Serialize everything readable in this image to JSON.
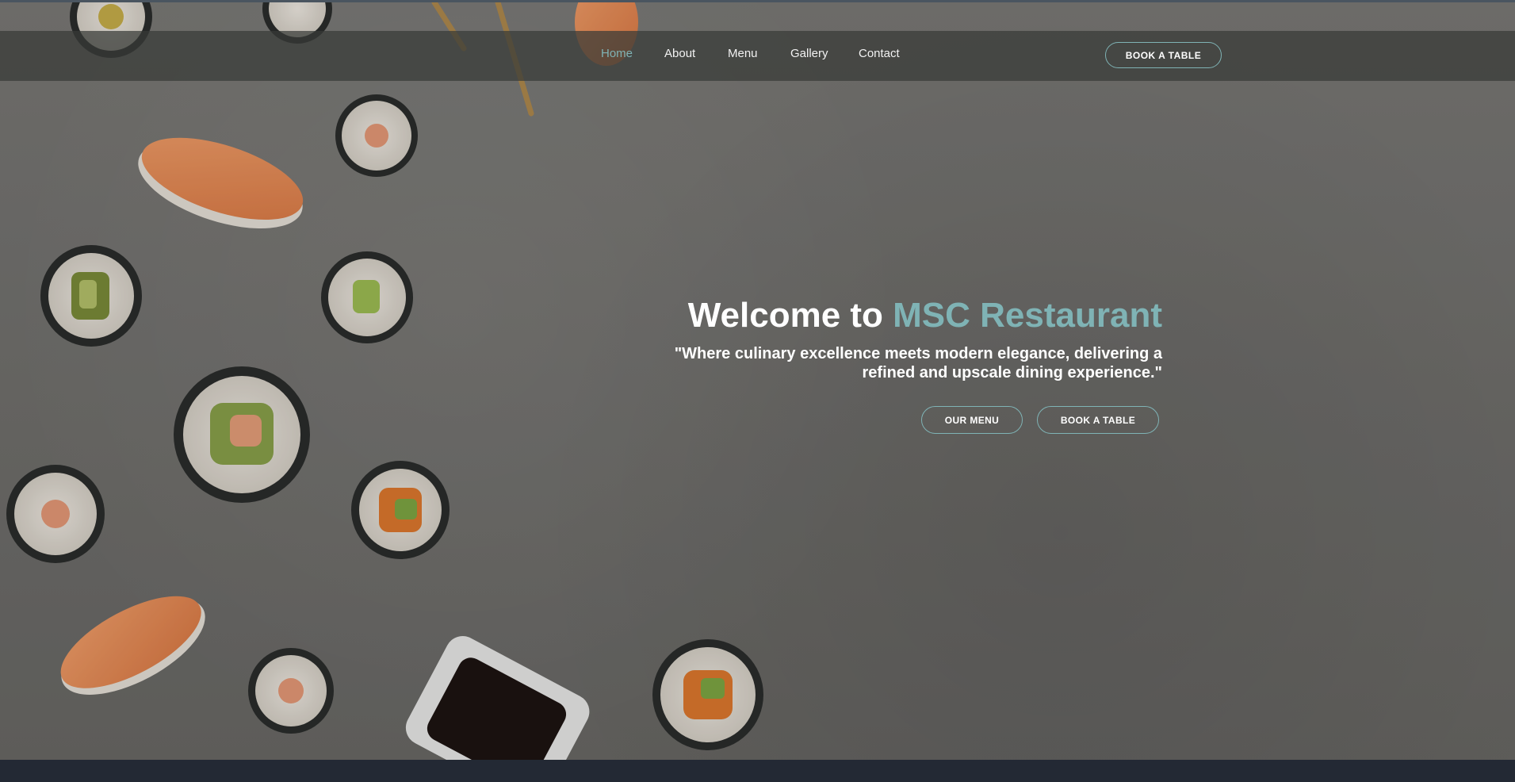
{
  "nav": {
    "links": [
      {
        "label": "Home",
        "active": true
      },
      {
        "label": "About",
        "active": false
      },
      {
        "label": "Menu",
        "active": false
      },
      {
        "label": "Gallery",
        "active": false
      },
      {
        "label": "Contact",
        "active": false
      }
    ],
    "cta_label": "BOOK A TABLE"
  },
  "hero": {
    "title_prefix": "Welcome to ",
    "title_brand": "MSC Restaurant",
    "subtitle_line1": "\"Where culinary excellence meets modern elegance, delivering a",
    "subtitle_line2": "refined and upscale dining experience.\"",
    "menu_button_label": "OUR MENU",
    "book_button_label": "BOOK A TABLE",
    "background_image": "sushi-on-concrete-photo"
  },
  "colors": {
    "accent": "#7fb3b5",
    "navbar": "#383a38",
    "footer_strip": "#232934",
    "text": "#ffffff"
  }
}
